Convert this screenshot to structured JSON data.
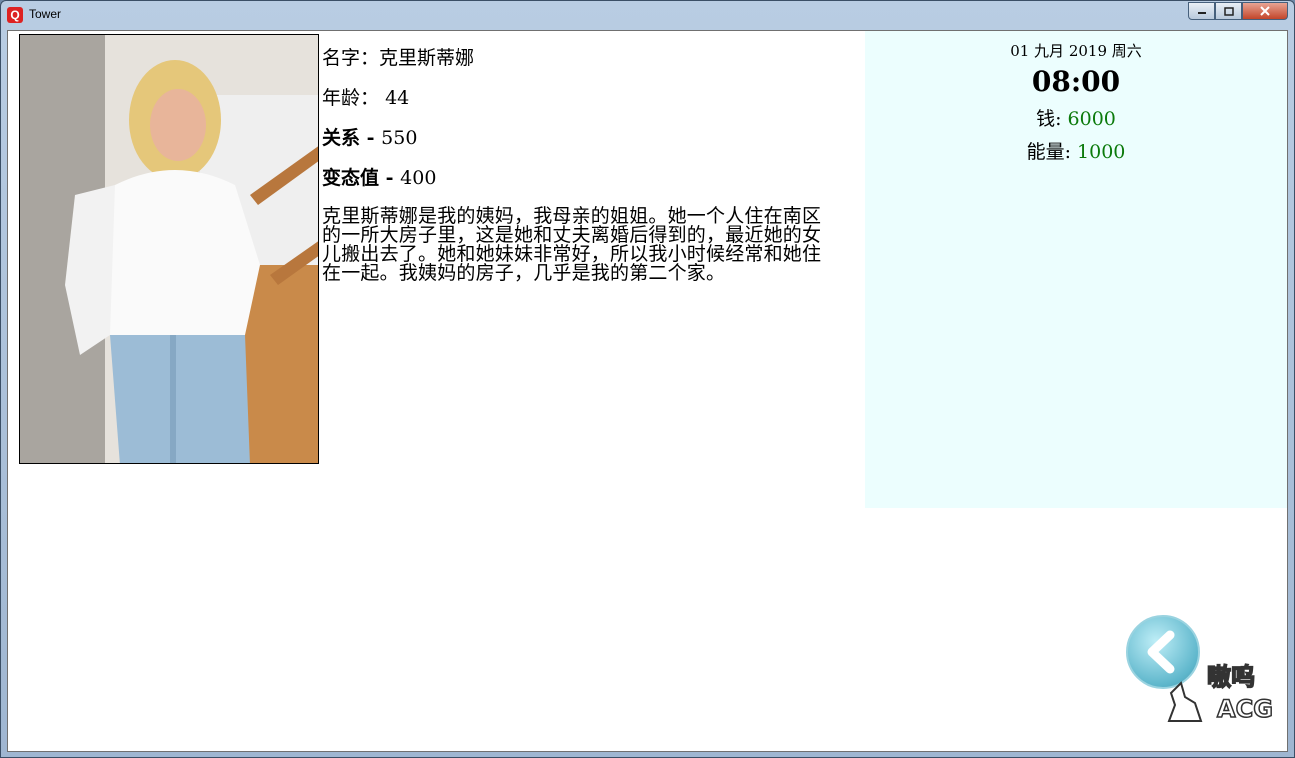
{
  "window": {
    "title": "Tower"
  },
  "character": {
    "name_label": "名字：",
    "name": "克里斯蒂娜",
    "age_label": "年龄：",
    "age": "44",
    "relation_label": "关系",
    "relation_sep": " - ",
    "relation_value": "550",
    "perv_label": "变态值",
    "perv_sep": " - ",
    "perv_value": "400",
    "description": "克里斯蒂娜是我的姨妈，我母亲的姐姐。她一个人住在南区的一所大房子里，这是她和丈夫离婚后得到的，最近她的女儿搬出去了。她和她妹妹非常好，所以我小时候经常和她住在一起。我姨妈的房子，几乎是我的第二个家。"
  },
  "status": {
    "date": "01 九月 2019 周六",
    "time": "08:00",
    "money_label": "钱: ",
    "money": "6000",
    "energy_label": "能量: ",
    "energy": "1000"
  },
  "watermark": {
    "text_top": "嗷呜",
    "text_bottom": "ACG"
  },
  "colors": {
    "panel_bg": "#ecfefe",
    "value_green": "#0b7a0b"
  },
  "icons": {
    "back": "chevron-left-icon"
  }
}
